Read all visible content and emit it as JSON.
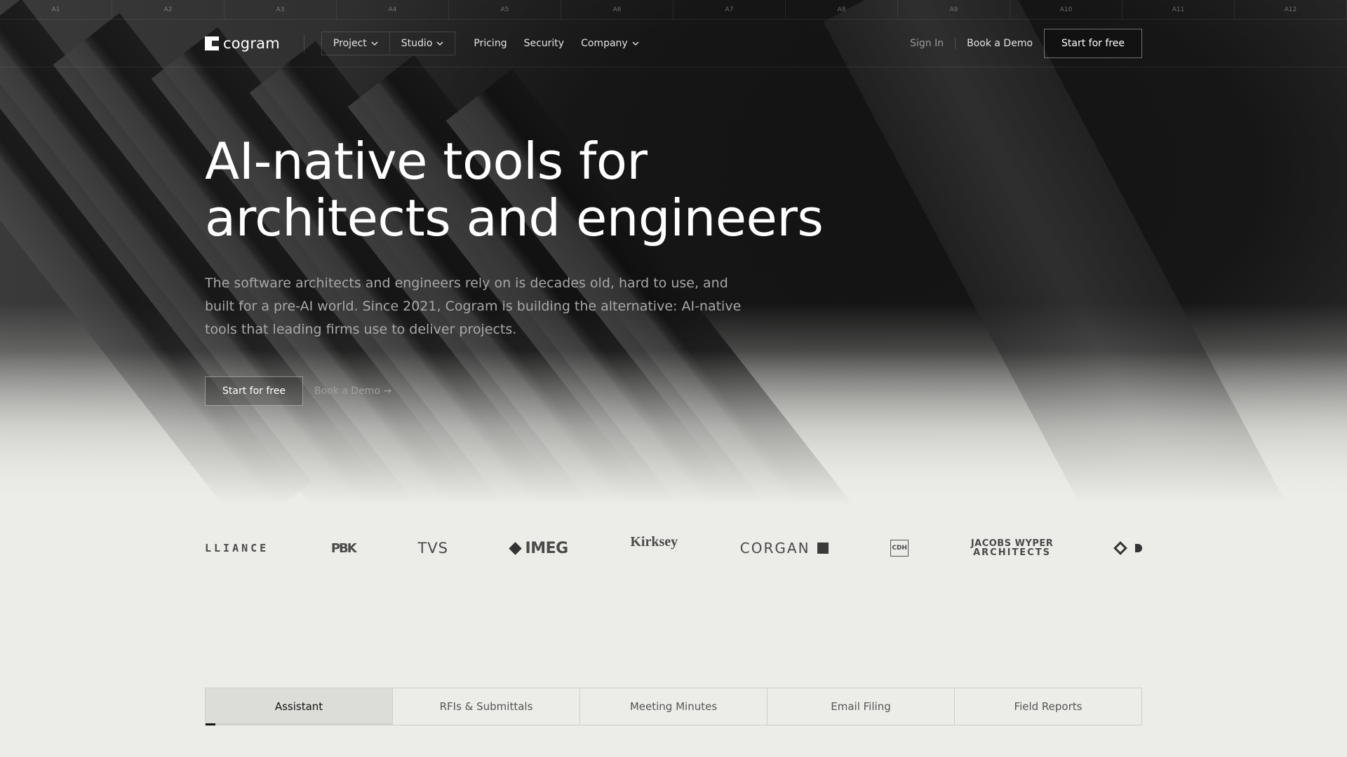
{
  "ruler": [
    "A1",
    "A2",
    "A3",
    "A4",
    "A5",
    "A6",
    "A7",
    "A8",
    "A9",
    "A10",
    "A11",
    "A12"
  ],
  "brand": {
    "name": "cogram"
  },
  "nav": {
    "dropdowns": [
      {
        "label": "Project"
      },
      {
        "label": "Studio"
      }
    ],
    "links": [
      "Pricing",
      "Security"
    ],
    "company": "Company",
    "sign_in": "Sign In",
    "book_demo": "Book a Demo",
    "start": "Start for free"
  },
  "hero": {
    "title_line1": "AI-native tools for",
    "title_line2": "architects and engineers",
    "subtitle": "The software architects and engineers rely on is decades old, hard to use, and built for a pre-AI world. Since 2021, Cogram is building the alternative: AI-native tools that leading firms use to deliver projects.",
    "primary_cta": "Start for free",
    "secondary_cta": "Book a Demo →"
  },
  "logos": {
    "lliance": "LLIANCE",
    "pbk": "PBK",
    "tvs": "TVS",
    "imeg": "IMEG",
    "kirksey": "Kirksey",
    "corgan": "CORGAN",
    "cdh": "CDH",
    "jw_line1": "JACOBS WYPER",
    "jw_line2": "ARCHITECTS"
  },
  "tabs": [
    {
      "label": "Assistant",
      "active": true
    },
    {
      "label": "RFIs & Submittals"
    },
    {
      "label": "Meeting Minutes"
    },
    {
      "label": "Email Filing"
    },
    {
      "label": "Field Reports"
    }
  ]
}
